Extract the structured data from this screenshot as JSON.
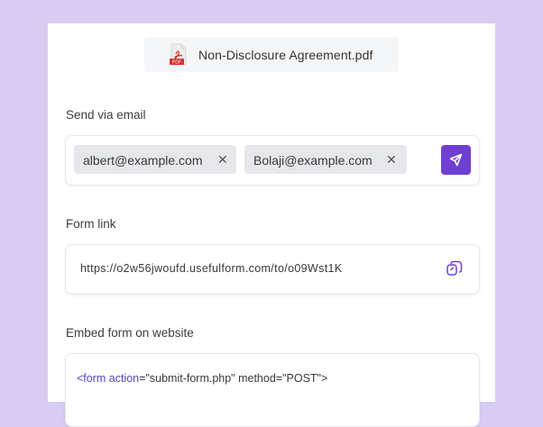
{
  "file": {
    "name": "Non-Disclosure Agreement.pdf",
    "icon": "pdf-file-icon",
    "icon_badge": "PDF"
  },
  "email_section": {
    "label": "Send via email",
    "recipients": [
      {
        "email": "albert@example.com",
        "remove_symbol": "✕"
      },
      {
        "email": "Bolaji@example.com",
        "remove_symbol": "✕"
      }
    ],
    "send_icon": "send-icon"
  },
  "link_section": {
    "label": "Form link",
    "url": "https://o2w56jwoufd.usefulform.com/to/o09Wst1K",
    "copy_icon": "copy-icon"
  },
  "embed_section": {
    "label": "Embed form on website",
    "code": {
      "open": "<form action",
      "rest": "=\"submit-form.php\" method=\"POST\">"
    }
  },
  "colors": {
    "accent": "#6f3fd3",
    "background": "#d9ccf1",
    "code_tag": "#5a3fc8"
  }
}
